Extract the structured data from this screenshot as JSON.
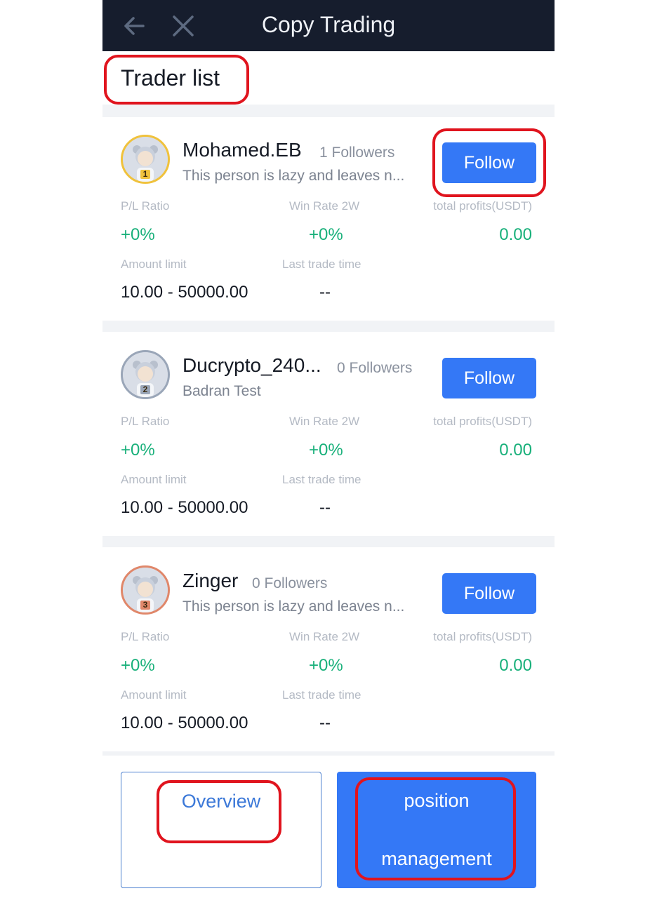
{
  "header": {
    "title": "Copy Trading"
  },
  "section": {
    "title": "Trader list"
  },
  "labels": {
    "pl_ratio": "P/L Ratio",
    "win_rate": "Win Rate 2W",
    "total_profits": "total profits(USDT)",
    "amount_limit": "Amount limit",
    "last_trade": "Last trade time",
    "follow": "Follow"
  },
  "traders": [
    {
      "rank": "1",
      "name": "Mohamed.EB",
      "followers": "1 Followers",
      "description": "This person is lazy and leaves n...",
      "pl_ratio": "+0%",
      "win_rate": "+0%",
      "total_profits": "0.00",
      "amount_limit": "10.00 - 50000.00",
      "last_trade": "--",
      "ring_color": "#f0c23c"
    },
    {
      "rank": "2",
      "name": "Ducrypto_240...",
      "followers": "0 Followers",
      "description": "Badran Test",
      "pl_ratio": "+0%",
      "win_rate": "+0%",
      "total_profits": "0.00",
      "amount_limit": "10.00 - 50000.00",
      "last_trade": "--",
      "ring_color": "#9aa6b8"
    },
    {
      "rank": "3",
      "name": "Zinger",
      "followers": "0 Followers",
      "description": "This person is lazy and leaves n...",
      "pl_ratio": "+0%",
      "win_rate": "+0%",
      "total_profits": "0.00",
      "amount_limit": "10.00 - 50000.00",
      "last_trade": "--",
      "ring_color": "#e0876a"
    }
  ],
  "bottom": {
    "overview": "Overview",
    "position_line1": "position",
    "position_line2": "management"
  },
  "colors": {
    "topbar": "#161d2d",
    "accent": "#3478f6",
    "positive": "#18b07a",
    "highlight": "#e0141e"
  }
}
